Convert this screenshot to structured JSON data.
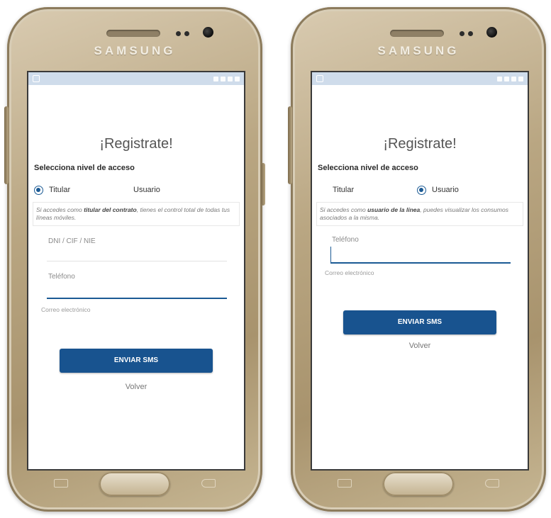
{
  "brand": "SAMSUNG",
  "colors": {
    "accent": "#18538f",
    "statusbar": "#cfdceb",
    "phone_body": "#b9a682"
  },
  "left_screen": {
    "title": "¡Registrate!",
    "access_label": "Selecciona nivel de acceso",
    "radio_titular": "Titular",
    "radio_usuario": "Usuario",
    "selected": "Titular",
    "info_prefix": "Si accedes como ",
    "info_bold": "titular del contrato",
    "info_suffix": ", tienes el control total de todas tus líneas móviles.",
    "doc_placeholder": "DNI / CIF / NIE",
    "phone_label": "Teléfono",
    "email_label": "Correo electrónico",
    "send_button": "ENVIAR SMS",
    "back_link": "Volver"
  },
  "right_screen": {
    "title": "¡Registrate!",
    "access_label": "Selecciona nivel de acceso",
    "radio_titular": "Titular",
    "radio_usuario": "Usuario",
    "selected": "Usuario",
    "info_prefix": "Si accedes como ",
    "info_bold": "usuario de la línea",
    "info_suffix": ", puedes visualizar los consumos asociados a la misma.",
    "phone_label": "Teléfono",
    "email_label": "Correo electrónico",
    "send_button": "ENVIAR SMS",
    "back_link": "Volver"
  }
}
